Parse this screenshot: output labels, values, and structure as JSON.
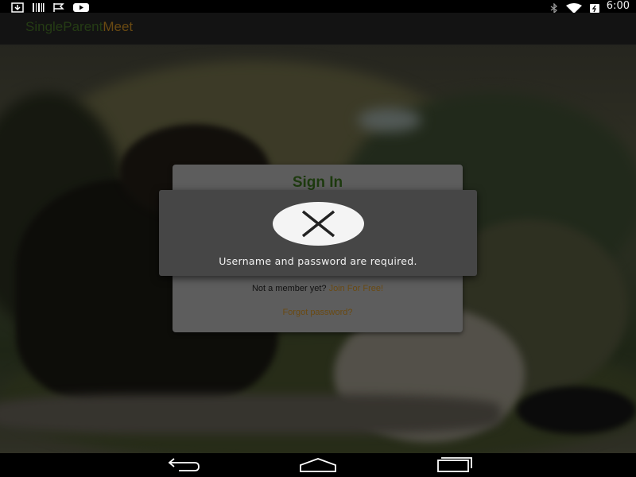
{
  "status_bar": {
    "icons_left": [
      "download-icon",
      "barcode-icon",
      "flag-icon",
      "youtube-icon"
    ],
    "icons_right": [
      "bluetooth-icon",
      "wifi-icon",
      "battery-icon"
    ],
    "time": "6:00"
  },
  "app_bar": {
    "title_part1": "SingleParent",
    "title_part2": "Meet"
  },
  "signin": {
    "title": "Sign In",
    "not_member": "Not a member yet?",
    "join_link": "Join For Free!",
    "forgot_link": "Forgot password?"
  },
  "error": {
    "icon": "x-icon",
    "message": "Username and password are required."
  },
  "nav_bar": {
    "buttons": [
      "back-icon",
      "home-icon",
      "recents-icon"
    ]
  },
  "colors": {
    "brand_green": "#253c14",
    "brand_brown": "#6a4a12",
    "dialog_bg": "#464646",
    "card_bg": "#5d5d5d"
  }
}
